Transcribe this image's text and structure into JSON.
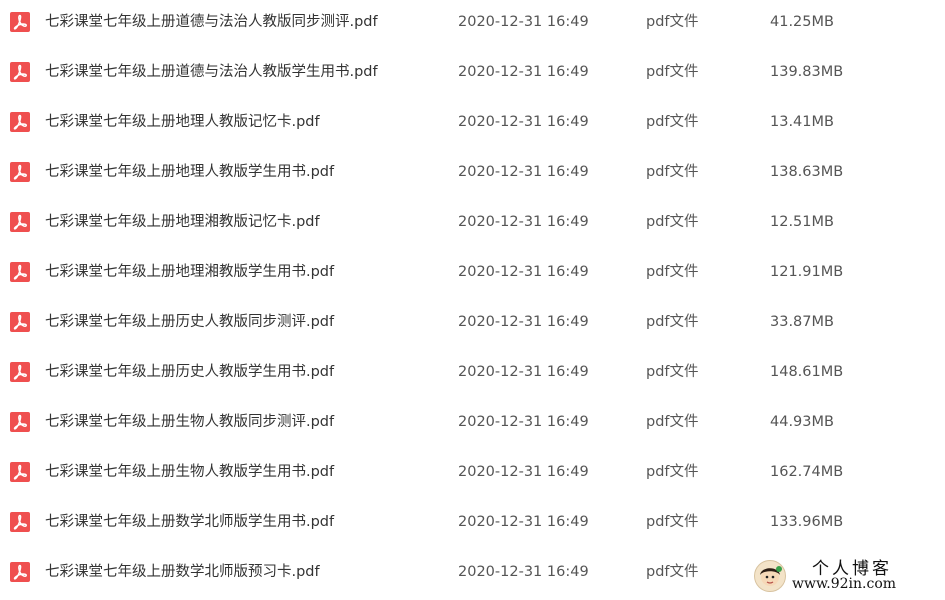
{
  "files": [
    {
      "name": "七彩课堂七年级上册道德与法治人教版同步测评.pdf",
      "date": "2020-12-31 16:49",
      "type": "pdf文件",
      "size": "41.25MB"
    },
    {
      "name": "七彩课堂七年级上册道德与法治人教版学生用书.pdf",
      "date": "2020-12-31 16:49",
      "type": "pdf文件",
      "size": "139.83MB"
    },
    {
      "name": "七彩课堂七年级上册地理人教版记忆卡.pdf",
      "date": "2020-12-31 16:49",
      "type": "pdf文件",
      "size": "13.41MB"
    },
    {
      "name": "七彩课堂七年级上册地理人教版学生用书.pdf",
      "date": "2020-12-31 16:49",
      "type": "pdf文件",
      "size": "138.63MB"
    },
    {
      "name": "七彩课堂七年级上册地理湘教版记忆卡.pdf",
      "date": "2020-12-31 16:49",
      "type": "pdf文件",
      "size": "12.51MB"
    },
    {
      "name": "七彩课堂七年级上册地理湘教版学生用书.pdf",
      "date": "2020-12-31 16:49",
      "type": "pdf文件",
      "size": "121.91MB"
    },
    {
      "name": "七彩课堂七年级上册历史人教版同步测评.pdf",
      "date": "2020-12-31 16:49",
      "type": "pdf文件",
      "size": "33.87MB"
    },
    {
      "name": "七彩课堂七年级上册历史人教版学生用书.pdf",
      "date": "2020-12-31 16:49",
      "type": "pdf文件",
      "size": "148.61MB"
    },
    {
      "name": "七彩课堂七年级上册生物人教版同步测评.pdf",
      "date": "2020-12-31 16:49",
      "type": "pdf文件",
      "size": "44.93MB"
    },
    {
      "name": "七彩课堂七年级上册生物人教版学生用书.pdf",
      "date": "2020-12-31 16:49",
      "type": "pdf文件",
      "size": "162.74MB"
    },
    {
      "name": "七彩课堂七年级上册数学北师版学生用书.pdf",
      "date": "2020-12-31 16:49",
      "type": "pdf文件",
      "size": "133.96MB"
    },
    {
      "name": "七彩课堂七年级上册数学北师版预习卡.pdf",
      "date": "2020-12-31 16:49",
      "type": "pdf文件",
      "size": ""
    }
  ],
  "icons": {
    "file_icon": "pdf-file-icon",
    "file_icon_color": "#ef4f4f"
  },
  "watermark": {
    "title": "个人博客",
    "url": "www.92in.com"
  }
}
